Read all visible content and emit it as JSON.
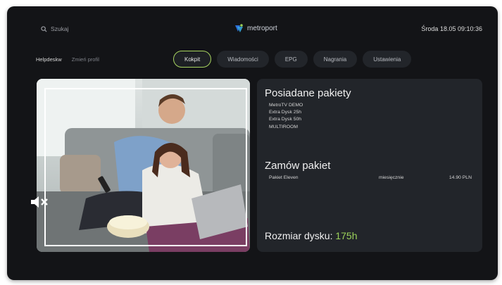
{
  "header": {
    "search_label": "Szukaj",
    "logo_text": "metroport",
    "datetime": "Środa 18.05 09:10:36"
  },
  "nav": {
    "helpdesk": "Helpdeskw",
    "change_profile": "Zmień profil",
    "tabs": [
      {
        "label": "Kokpit",
        "active": true
      },
      {
        "label": "Wiadomości",
        "active": false
      },
      {
        "label": "EPG",
        "active": false
      },
      {
        "label": "Nagrania",
        "active": false
      },
      {
        "label": "Ustawienia",
        "active": false
      }
    ]
  },
  "owned_packages": {
    "title": "Posiadane pakiety",
    "items": [
      "MetroTV DEMO",
      "Extra Dysk 25h",
      "Extra Dysk 50h",
      "MULTIROOM"
    ]
  },
  "order_package": {
    "title": "Zamów pakiet",
    "rows": [
      {
        "name": "Pakiet Eleven",
        "period": "miesięcznie",
        "price": "14.90 PLN"
      }
    ]
  },
  "disk": {
    "label": "Rozmiar dysku:",
    "value": "175h"
  },
  "video": {
    "muted": true
  },
  "colors": {
    "accent": "#a7d35f",
    "disk_value": "#9bd15a",
    "background": "#131417",
    "panel": "#22252a"
  },
  "icons": [
    "search-icon",
    "metroport-logo-icon",
    "mute-icon"
  ]
}
